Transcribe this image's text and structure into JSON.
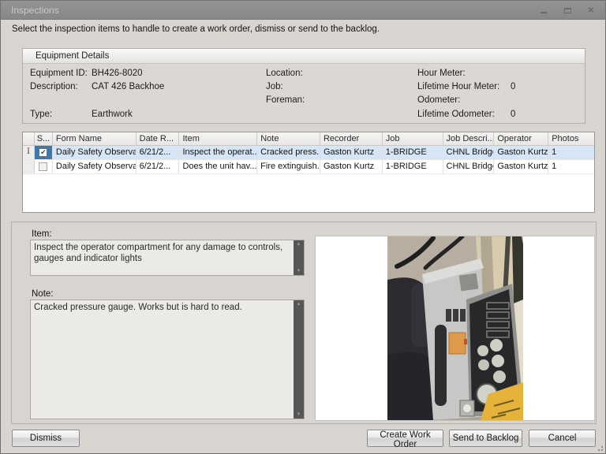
{
  "window": {
    "title": "Inspections"
  },
  "icons": {
    "check": "✔",
    "close": "✕",
    "scroll_up": "▲",
    "scroll_down": "▼",
    "row_indicator": "I"
  },
  "instruction": "Select the inspection items to handle to create a work order, dismiss or send to the backlog.",
  "equipment_details": {
    "title": "Equipment Details",
    "left": [
      {
        "label": "Equipment ID:",
        "value": "BH426-8020"
      },
      {
        "label": "Description:",
        "value": "CAT 426 Backhoe"
      },
      {
        "label": "Type:",
        "value": "Earthwork"
      }
    ],
    "mid": [
      {
        "label": "Location:",
        "value": ""
      },
      {
        "label": "Job:",
        "value": ""
      },
      {
        "label": "Foreman:",
        "value": ""
      }
    ],
    "right": [
      {
        "label": "Hour Meter:",
        "value": ""
      },
      {
        "label": "Lifetime Hour Meter:",
        "value": "0"
      },
      {
        "label": "Odometer:",
        "value": ""
      },
      {
        "label": "Lifetime Odometer:",
        "value": "0"
      }
    ]
  },
  "grid": {
    "columns": [
      "S...",
      "Form Name",
      "Date R...",
      "Item",
      "Note",
      "Recorder",
      "Job",
      "Job Descri...",
      "Operator",
      "Photos"
    ],
    "rows": [
      {
        "form_name": "Daily Safety Observa...",
        "date": "6/21/2...",
        "item": "Inspect the operat...",
        "note": "Cracked press...",
        "recorder": "Gaston Kurtz",
        "job": "1-BRIDGE",
        "job_desc": "CHNL Bridge",
        "operator": "Gaston Kurtz",
        "photos": "1"
      },
      {
        "form_name": "Daily Safety Observa...",
        "date": "6/21/2...",
        "item": "Does the unit hav...",
        "note": "Fire extinguish...",
        "recorder": "Gaston Kurtz",
        "job": "1-BRIDGE",
        "job_desc": "CHNL Bridge",
        "operator": "Gaston Kurtz",
        "photos": "1"
      }
    ]
  },
  "detail": {
    "item_label": "Item:",
    "item_text": "Inspect the operator compartment for any damage  to controls, gauges and indicator lights",
    "note_label": "Note:",
    "note_text": "Cracked pressure gauge. Works but is hard to read."
  },
  "buttons": {
    "dismiss": "Dismiss",
    "create_work_order": "Create Work Order",
    "send_to_backlog": "Send to Backlog",
    "cancel": "Cancel"
  },
  "colors": {
    "title_bar": "#8b8b8b",
    "dialog_bg": "#d8d5d1",
    "selection_blue": "#3d78ad",
    "row_highlight": "#d6e6f6"
  }
}
